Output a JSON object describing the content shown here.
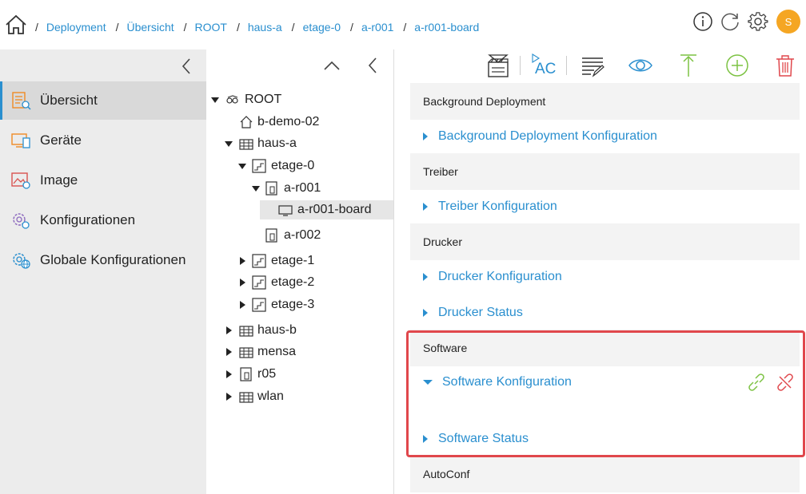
{
  "breadcrumb": [
    {
      "label": "Deployment"
    },
    {
      "label": "Übersicht"
    },
    {
      "label": "ROOT"
    },
    {
      "label": "haus-a"
    },
    {
      "label": "etage-0"
    },
    {
      "label": "a-r001"
    },
    {
      "label": "a-r001-board"
    }
  ],
  "breadcrumb_separator": "/",
  "header": {
    "avatar_initial": "S",
    "icons": [
      "info-icon",
      "refresh-icon",
      "settings-icon"
    ]
  },
  "nav": {
    "items": [
      {
        "label": "Übersicht",
        "icon": "overview-icon",
        "active": true
      },
      {
        "label": "Geräte",
        "icon": "devices-icon"
      },
      {
        "label": "Image",
        "icon": "image-icon"
      },
      {
        "label": "Konfigurationen",
        "icon": "config-icon"
      },
      {
        "label": "Globale Konfigurationen",
        "icon": "global-config-icon"
      }
    ]
  },
  "tree": {
    "nodes": [
      {
        "label": "ROOT",
        "icon": "root-icon",
        "expanded": true
      },
      {
        "label": "b-demo-02",
        "icon": "home-icon"
      },
      {
        "label": "haus-a",
        "icon": "building-icon",
        "expanded": true
      },
      {
        "label": "etage-0",
        "icon": "floor-icon",
        "expanded": true
      },
      {
        "label": "a-r001",
        "icon": "room-icon",
        "expanded": true
      },
      {
        "label": "a-r001-board",
        "icon": "board-icon",
        "selected": true
      },
      {
        "label": "a-r002",
        "icon": "room-icon"
      },
      {
        "label": "etage-1",
        "icon": "floor-icon"
      },
      {
        "label": "etage-2",
        "icon": "floor-icon"
      },
      {
        "label": "etage-3",
        "icon": "floor-icon"
      },
      {
        "label": "haus-b",
        "icon": "building-icon"
      },
      {
        "label": "mensa",
        "icon": "building-icon"
      },
      {
        "label": "r05",
        "icon": "room-icon"
      },
      {
        "label": "wlan",
        "icon": "building-icon"
      }
    ]
  },
  "toolbar": {
    "icons": [
      "clapperboard-icon",
      "autocomplete-icon",
      "list-edit-icon",
      "eye-icon",
      "upload-arrow-icon",
      "add-circle-icon",
      "trash-icon"
    ],
    "ac_label": "AC"
  },
  "sections": [
    {
      "title": "Background Deployment",
      "rows": [
        {
          "label": "Background Deployment Konfiguration",
          "expanded": false
        }
      ]
    },
    {
      "title": "Treiber",
      "rows": [
        {
          "label": "Treiber Konfiguration",
          "expanded": false
        }
      ]
    },
    {
      "title": "Drucker",
      "rows": [
        {
          "label": "Drucker Konfiguration",
          "expanded": false
        },
        {
          "label": "Drucker Status",
          "expanded": false
        }
      ]
    },
    {
      "title": "Software",
      "rows": [
        {
          "label": "Software Konfiguration",
          "expanded": true
        },
        {
          "label": "Software Status",
          "expanded": false
        }
      ]
    },
    {
      "title": "AutoConf",
      "rows": []
    }
  ],
  "colors": {
    "link": "#2a8fcf",
    "highlight": "#e0474c",
    "link_icon": "#7cc242",
    "unlink_icon": "#e0474c",
    "add_icon": "#7cc242",
    "trash_icon": "#e0474c",
    "avatar": "#f5a623"
  }
}
